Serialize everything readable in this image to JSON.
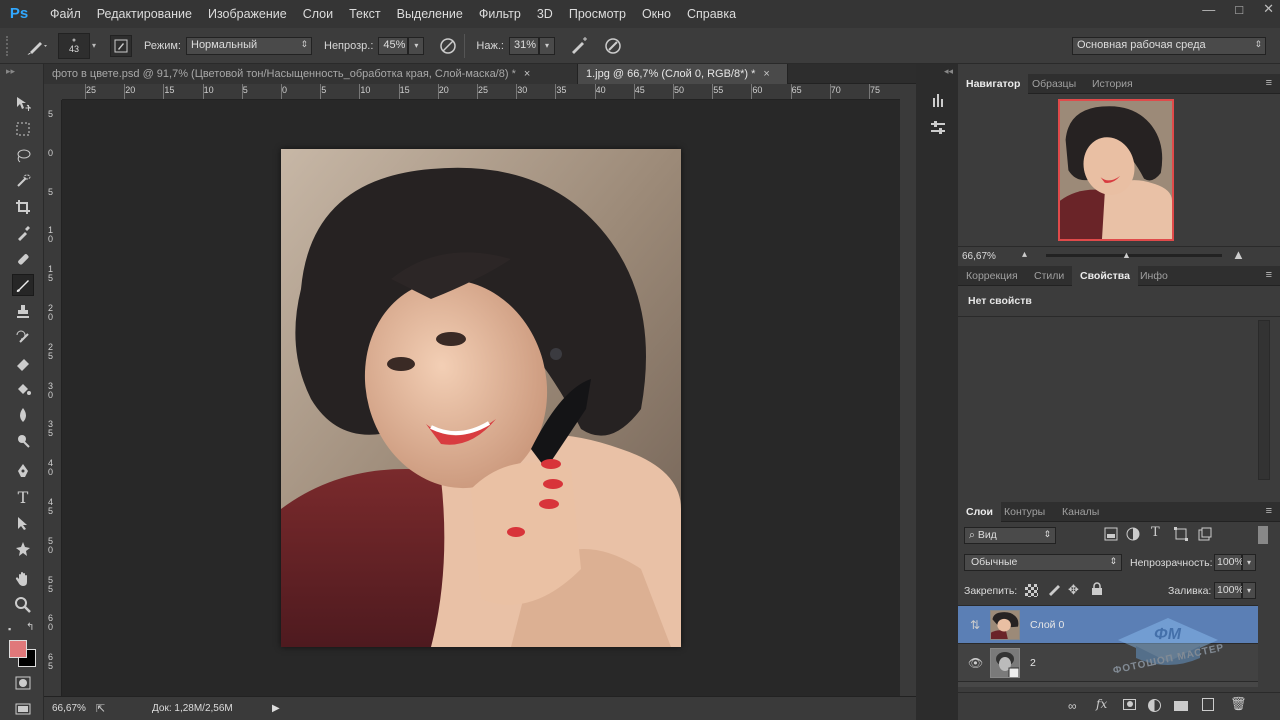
{
  "app": {
    "logo": "Ps"
  },
  "menu": [
    "Файл",
    "Редактирование",
    "Изображение",
    "Слои",
    "Текст",
    "Выделение",
    "Фильтр",
    "3D",
    "Просмотр",
    "Окно",
    "Справка"
  ],
  "window_controls": {
    "minimize": "—",
    "maximize": "□",
    "close": "✕"
  },
  "options": {
    "brush_size": "43",
    "mode_label": "Режим:",
    "mode_value": "Нормальный",
    "opacity_label": "Непрозр.:",
    "opacity_value": "45%",
    "flow_label": "Наж.:",
    "flow_value": "31%",
    "workspace": "Основная рабочая среда"
  },
  "tabs": [
    {
      "title": "фото в цвете.psd @ 91,7% (Цветовой тон/Насыщенность_обработка края, Слой-маска/8) *",
      "close": "×"
    },
    {
      "title": "1.jpg @ 66,7% (Слой 0, RGB/8*) *",
      "close": "×"
    }
  ],
  "ruler_h": [
    "25",
    "20",
    "15",
    "10",
    "5",
    "0",
    "5",
    "10",
    "15",
    "20",
    "25",
    "30",
    "35",
    "40",
    "45",
    "50",
    "55",
    "60",
    "65",
    "70",
    "75"
  ],
  "ruler_v": [
    "5",
    "0",
    "5",
    "1 0",
    "1 5",
    "2 0",
    "2 5",
    "3 0",
    "3 5",
    "4 0",
    "4 5",
    "5 0",
    "5 5",
    "6 0",
    "6 5"
  ],
  "status": {
    "zoom": "66,67%",
    "doc": "Док: 1,28M/2,56M"
  },
  "colors": {
    "foreground": "#e0787a",
    "background": "#000000",
    "accent": "#5b7fb5"
  },
  "navigator": {
    "tabs": [
      "Навигатор",
      "Образцы",
      "История"
    ],
    "zoom": "66,67%"
  },
  "properties": {
    "tabs": [
      "Коррекция",
      "Стили",
      "Свойства",
      "Инфо"
    ],
    "empty_text": "Нет свойств"
  },
  "layers": {
    "tabs": [
      "Слои",
      "Контуры",
      "Каналы"
    ],
    "filter": "Вид",
    "blend_mode": "Обычные",
    "opacity_label": "Непрозрачность:",
    "opacity_value": "100%",
    "lock_label": "Закрепить:",
    "fill_label": "Заливка:",
    "fill_value": "100%",
    "items": [
      {
        "name": "Слой 0"
      },
      {
        "name": "2"
      }
    ]
  },
  "watermark": {
    "logo": "ФМ",
    "text": "ФОТОШОП МАСТЕР"
  }
}
